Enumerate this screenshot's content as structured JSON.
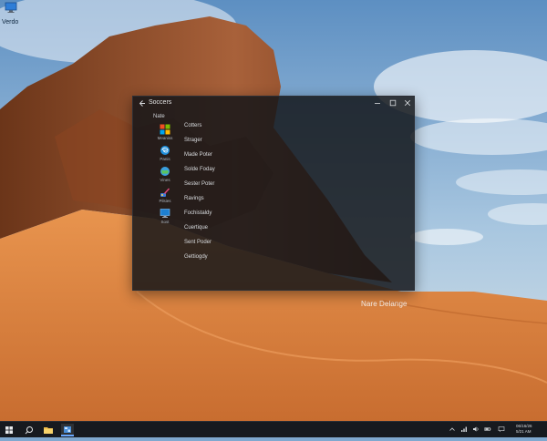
{
  "desktop": {
    "icon": {
      "label": "Verdo",
      "icon": "monitor-icon"
    },
    "watermark": "Nare Delange"
  },
  "window": {
    "title": "Soccers",
    "back_icon": "arrow-left-icon",
    "controls": {
      "minimize_icon": "minimize-icon",
      "maximize_icon": "maximize-icon",
      "close_icon": "close-icon"
    },
    "nav_header": "Nate",
    "nav_items": [
      {
        "label": "Meaniss",
        "icon": "windows-logo-icon"
      },
      {
        "label": "Panis",
        "icon": "edge-icon"
      },
      {
        "label": "Vines",
        "icon": "globe-icon"
      },
      {
        "label": "Pilsies",
        "icon": "paint-icon"
      },
      {
        "label": "Sost",
        "icon": "display-icon"
      }
    ],
    "menu_items": [
      "Cotters",
      "Strager",
      "Made Poter",
      "Solde Foday",
      "Sester Poter",
      "Ravings",
      "Fochistaldy",
      "Cuertique",
      "Sent Poder",
      "Gettiogdy"
    ]
  },
  "taskbar": {
    "start_icon": "windows-start-icon",
    "search_icon": "search-icon",
    "explorer_icon": "folder-icon",
    "app_icon": "settings-app-icon",
    "tray_icons": [
      "chevron-up-icon",
      "network-icon",
      "volume-icon",
      "battery-icon",
      "message-icon"
    ],
    "clock": {
      "line1": "06/16/26",
      "line2": "5/21 AM"
    }
  },
  "colors": {
    "accent": "#6aa8ff",
    "window_bg": "#121418",
    "taskbar_bg": "#171a1f"
  }
}
